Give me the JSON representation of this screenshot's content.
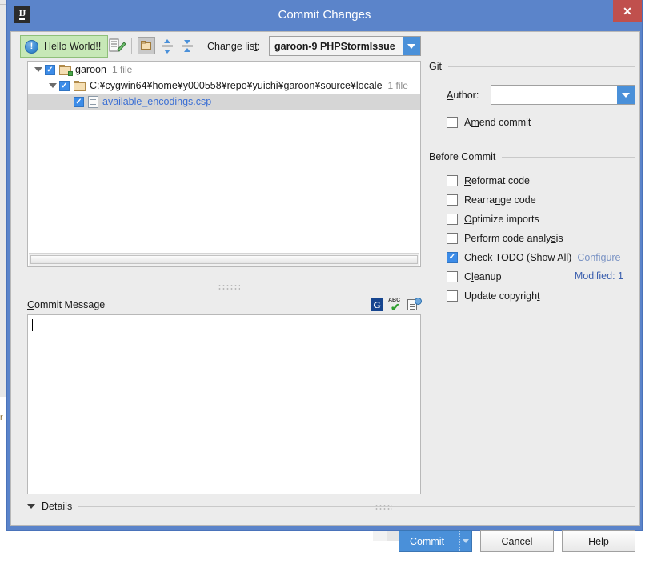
{
  "window": {
    "title": "Commit Changes",
    "logo_label": "IJ",
    "close_label": "✕"
  },
  "notification": {
    "text": "Hello World!!",
    "icon": "info-circle-icon"
  },
  "toolbar": {
    "changelist_label_pre": "Change lis",
    "changelist_label_mnemonic": "t",
    "changelist_label_post": ":",
    "changelist_value": "garoon-9 PHPStormIssue",
    "icons": [
      "diff-icon",
      "group-by-directory-icon",
      "expand-all-icon",
      "collapse-all-icon"
    ]
  },
  "tree": {
    "rows": [
      {
        "indent": 0,
        "twisty": true,
        "checked": true,
        "icon": "folder-changelist-icon",
        "name": "garoon",
        "count": "1 file",
        "link": false,
        "selected": false
      },
      {
        "indent": 1,
        "twisty": true,
        "checked": true,
        "icon": "folder-icon",
        "name": "C:¥cygwin64¥home¥y000558¥repo¥yuichi¥garoon¥source¥locale",
        "count": "1 file",
        "link": false,
        "selected": false
      },
      {
        "indent": 2,
        "twisty": false,
        "checked": true,
        "icon": "file-icon",
        "name": "available_encodings.csp",
        "count": "",
        "link": true,
        "selected": true
      }
    ],
    "modified_label": "Modified: 1"
  },
  "commit_message": {
    "label_mnemonic": "C",
    "label_rest": "ommit Message",
    "value": "",
    "icons": [
      "grammar-g-icon",
      "spellcheck-abc-icon",
      "message-history-icon"
    ]
  },
  "details": {
    "label": "Details"
  },
  "right_panel": {
    "git_group_title": "Git",
    "author_label_mnemonic": "A",
    "author_label_rest": "uthor:",
    "author_value": "",
    "amend": {
      "pre": "A",
      "mnemonic": "m",
      "post": "end commit",
      "checked": false
    },
    "before_commit_title": "Before Commit",
    "options": [
      {
        "pre": "",
        "mnemonic": "R",
        "post": "eformat code",
        "checked": false,
        "name": "reformat-code"
      },
      {
        "pre": "Rearra",
        "mnemonic": "n",
        "post": "ge code",
        "checked": false,
        "name": "rearrange-code"
      },
      {
        "pre": "",
        "mnemonic": "O",
        "post": "ptimize imports",
        "checked": false,
        "name": "optimize-imports"
      },
      {
        "pre": "Perform code analy",
        "mnemonic": "s",
        "post": "is",
        "checked": false,
        "name": "perform-code-analysis"
      },
      {
        "pre": "Check TODO (Show All)",
        "mnemonic": "",
        "post": "",
        "checked": true,
        "name": "check-todo",
        "link": "Configure"
      },
      {
        "pre": "C",
        "mnemonic": "l",
        "post": "eanup",
        "checked": false,
        "name": "cleanup"
      },
      {
        "pre": "Update copyrigh",
        "mnemonic": "t",
        "post": "",
        "checked": false,
        "name": "update-copyright"
      }
    ]
  },
  "footer": {
    "commit_label": "Commit",
    "cancel_label": "Cancel",
    "help_label": "Help"
  },
  "colors": {
    "titlebar": "#5b84ca",
    "accent": "#4a90d9",
    "close": "#c0504d",
    "notification_bg": "#c7e8b7",
    "link": "#3b6fd4",
    "modified": "#3b5fae"
  },
  "background": {
    "left_text": "r"
  }
}
